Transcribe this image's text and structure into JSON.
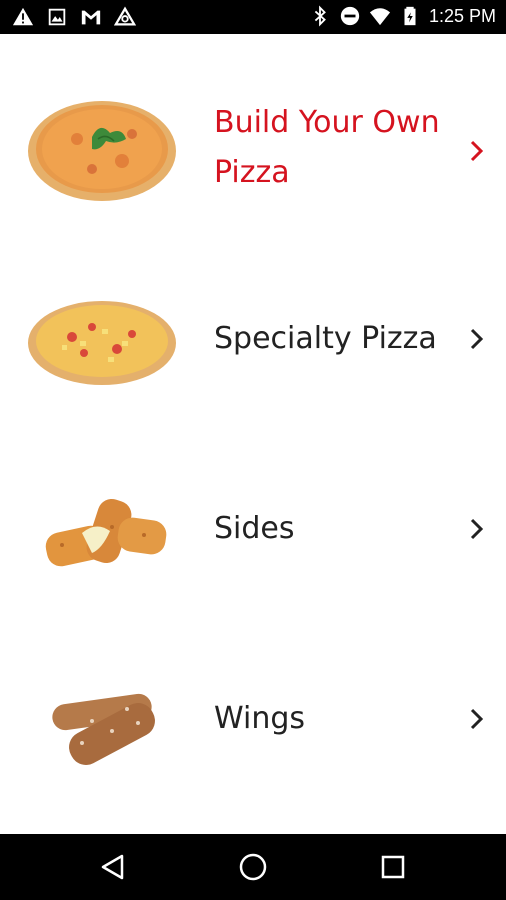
{
  "status_bar": {
    "time": "1:25 PM",
    "left_icons": [
      "warning-icon",
      "image-icon",
      "gmail-icon",
      "triangle-app-icon"
    ],
    "right_icons": [
      "bluetooth-icon",
      "do-not-disturb-icon",
      "wifi-icon",
      "battery-icon"
    ]
  },
  "menu": {
    "accent_color": "#d5131f",
    "items": [
      {
        "label": "Build Your Own Pizza",
        "line1": "Build Your Own",
        "line2": "Pizza",
        "image": "cheese-pizza-image",
        "active": true
      },
      {
        "label": "Specialty Pizza",
        "image": "hawaiian-pizza-image",
        "active": false
      },
      {
        "label": "Sides",
        "image": "mozzarella-sticks-image",
        "active": false
      },
      {
        "label": "Wings",
        "image": "chicken-wings-image",
        "active": false
      }
    ]
  },
  "nav_bar": {
    "buttons": [
      "back-icon",
      "home-icon",
      "recents-icon"
    ]
  }
}
